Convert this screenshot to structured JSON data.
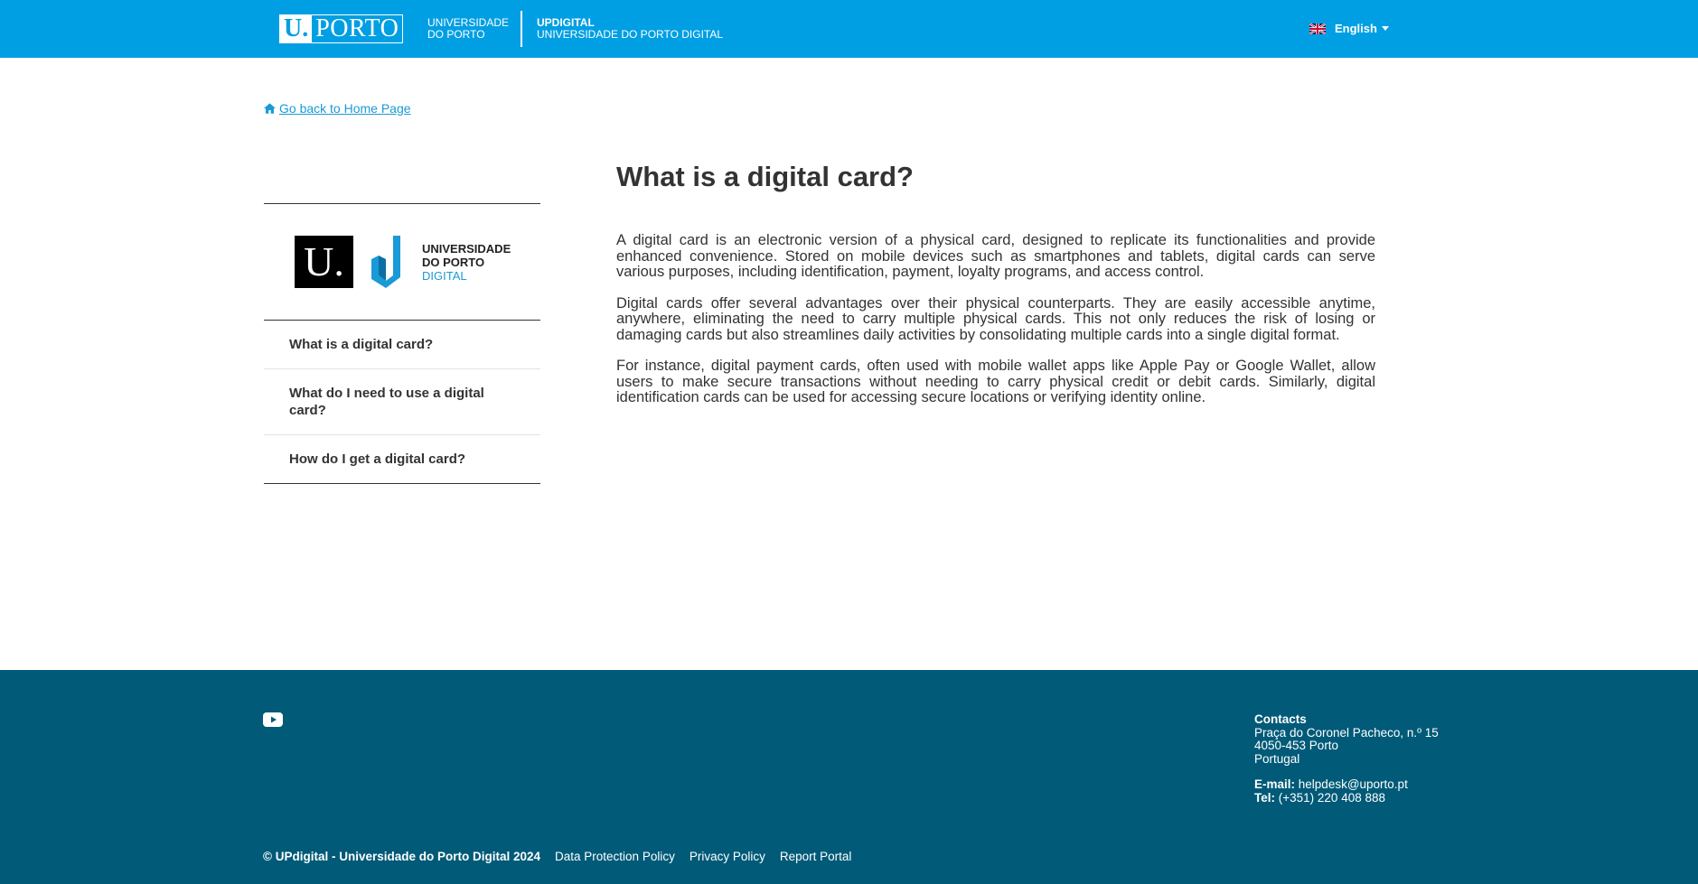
{
  "header": {
    "logo_u": "U.",
    "logo_porto": "PORTO",
    "uni_line1": "UNIVERSIDADE",
    "uni_line2": "DO PORTO",
    "updigital_line1": "UPDIGITAL",
    "updigital_line2": "UNIVERSIDADE DO PORTO DIGITAL",
    "language": "English"
  },
  "back_link": "Go back to Home Page",
  "sidebar": {
    "logo_u": "U.",
    "logo_line1": "UNIVERSIDADE",
    "logo_line2": "DO PORTO",
    "logo_line3": "DIGITAL",
    "items": [
      {
        "label": "What is a digital card?"
      },
      {
        "label": "What do I need to use a digital card?"
      },
      {
        "label": "How do I get a digital card?"
      }
    ]
  },
  "main": {
    "title": "What is a digital card?",
    "paragraphs": [
      "A digital card is an electronic version of a physical card, designed to replicate its functionalities and provide enhanced convenience. Stored on mobile devices such as smartphones and tablets, digital cards can serve various purposes, including identification, payment, loyalty programs, and access control.",
      "Digital cards offer several advantages over their physical counterparts. They are easily accessible anytime, anywhere, eliminating the need to carry multiple physical cards. This not only reduces the risk of losing or damaging cards but also streamlines daily activities by consolidating multiple cards into a single digital format.",
      "For instance, digital payment cards, often used with mobile wallet apps like Apple Pay or Google Wallet, allow users to make secure transactions without needing to carry physical credit or debit cards. Similarly, digital identification cards can be used for accessing secure locations or verifying identity online."
    ]
  },
  "footer": {
    "contacts_title": "Contacts",
    "address_line1": "Praça do Coronel Pacheco, n.º 15",
    "address_line2": "4050-453 Porto",
    "address_line3": "Portugal",
    "email_label": "E-mail:",
    "email": "helpdesk@uporto.pt",
    "tel_label": "Tel:",
    "tel": "(+351) 220 408 888",
    "copyright": "© UPdigital - Universidade do Porto Digital 2024",
    "links": [
      "Data Protection Policy",
      "Privacy Policy",
      "Report Portal"
    ]
  },
  "colors": {
    "header_bg": "#009fe3",
    "footer_bg": "#005a78",
    "link": "#1a9ad6"
  }
}
